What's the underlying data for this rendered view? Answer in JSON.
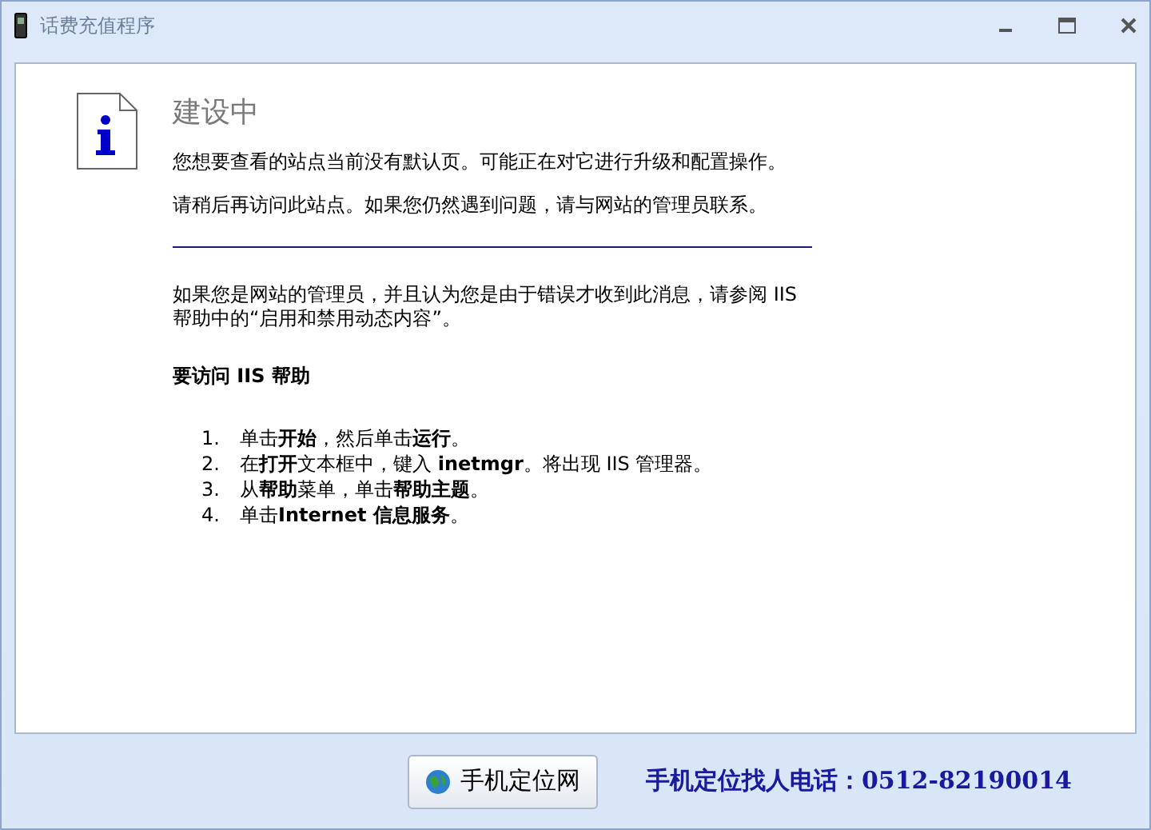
{
  "window": {
    "title": "话费充值程序"
  },
  "page": {
    "heading": "建设中",
    "paragraphs": [
      "您想要查看的站点当前没有默认页。可能正在对它进行升级和配置操作。",
      "请稍后再访问此站点。如果您仍然遇到问题，请与网站的管理员联系。"
    ],
    "admin_note": [
      "如果您是网站的管理员，并且认为您是由于错误才收到此消息，请参阅 IIS",
      "帮助中的“启用和禁用动态内容”。"
    ],
    "help_heading": "要访问 IIS 帮助",
    "steps": [
      {
        "number": "1.",
        "text": "单击**开始**，然后单击**运行**。"
      },
      {
        "number": "2.",
        "text": "在**打开**文本框中，键入 **inetmgr**。将出现 IIS 管理器。"
      },
      {
        "number": "3.",
        "text": "从**帮助**菜单，单击**帮助主题**。"
      },
      {
        "number": "4.",
        "text": "单击**Internet 信息服务**。"
      }
    ]
  },
  "footer": {
    "button": "手机定位网",
    "contact": "手机定位找人电话：0512-82190014"
  }
}
